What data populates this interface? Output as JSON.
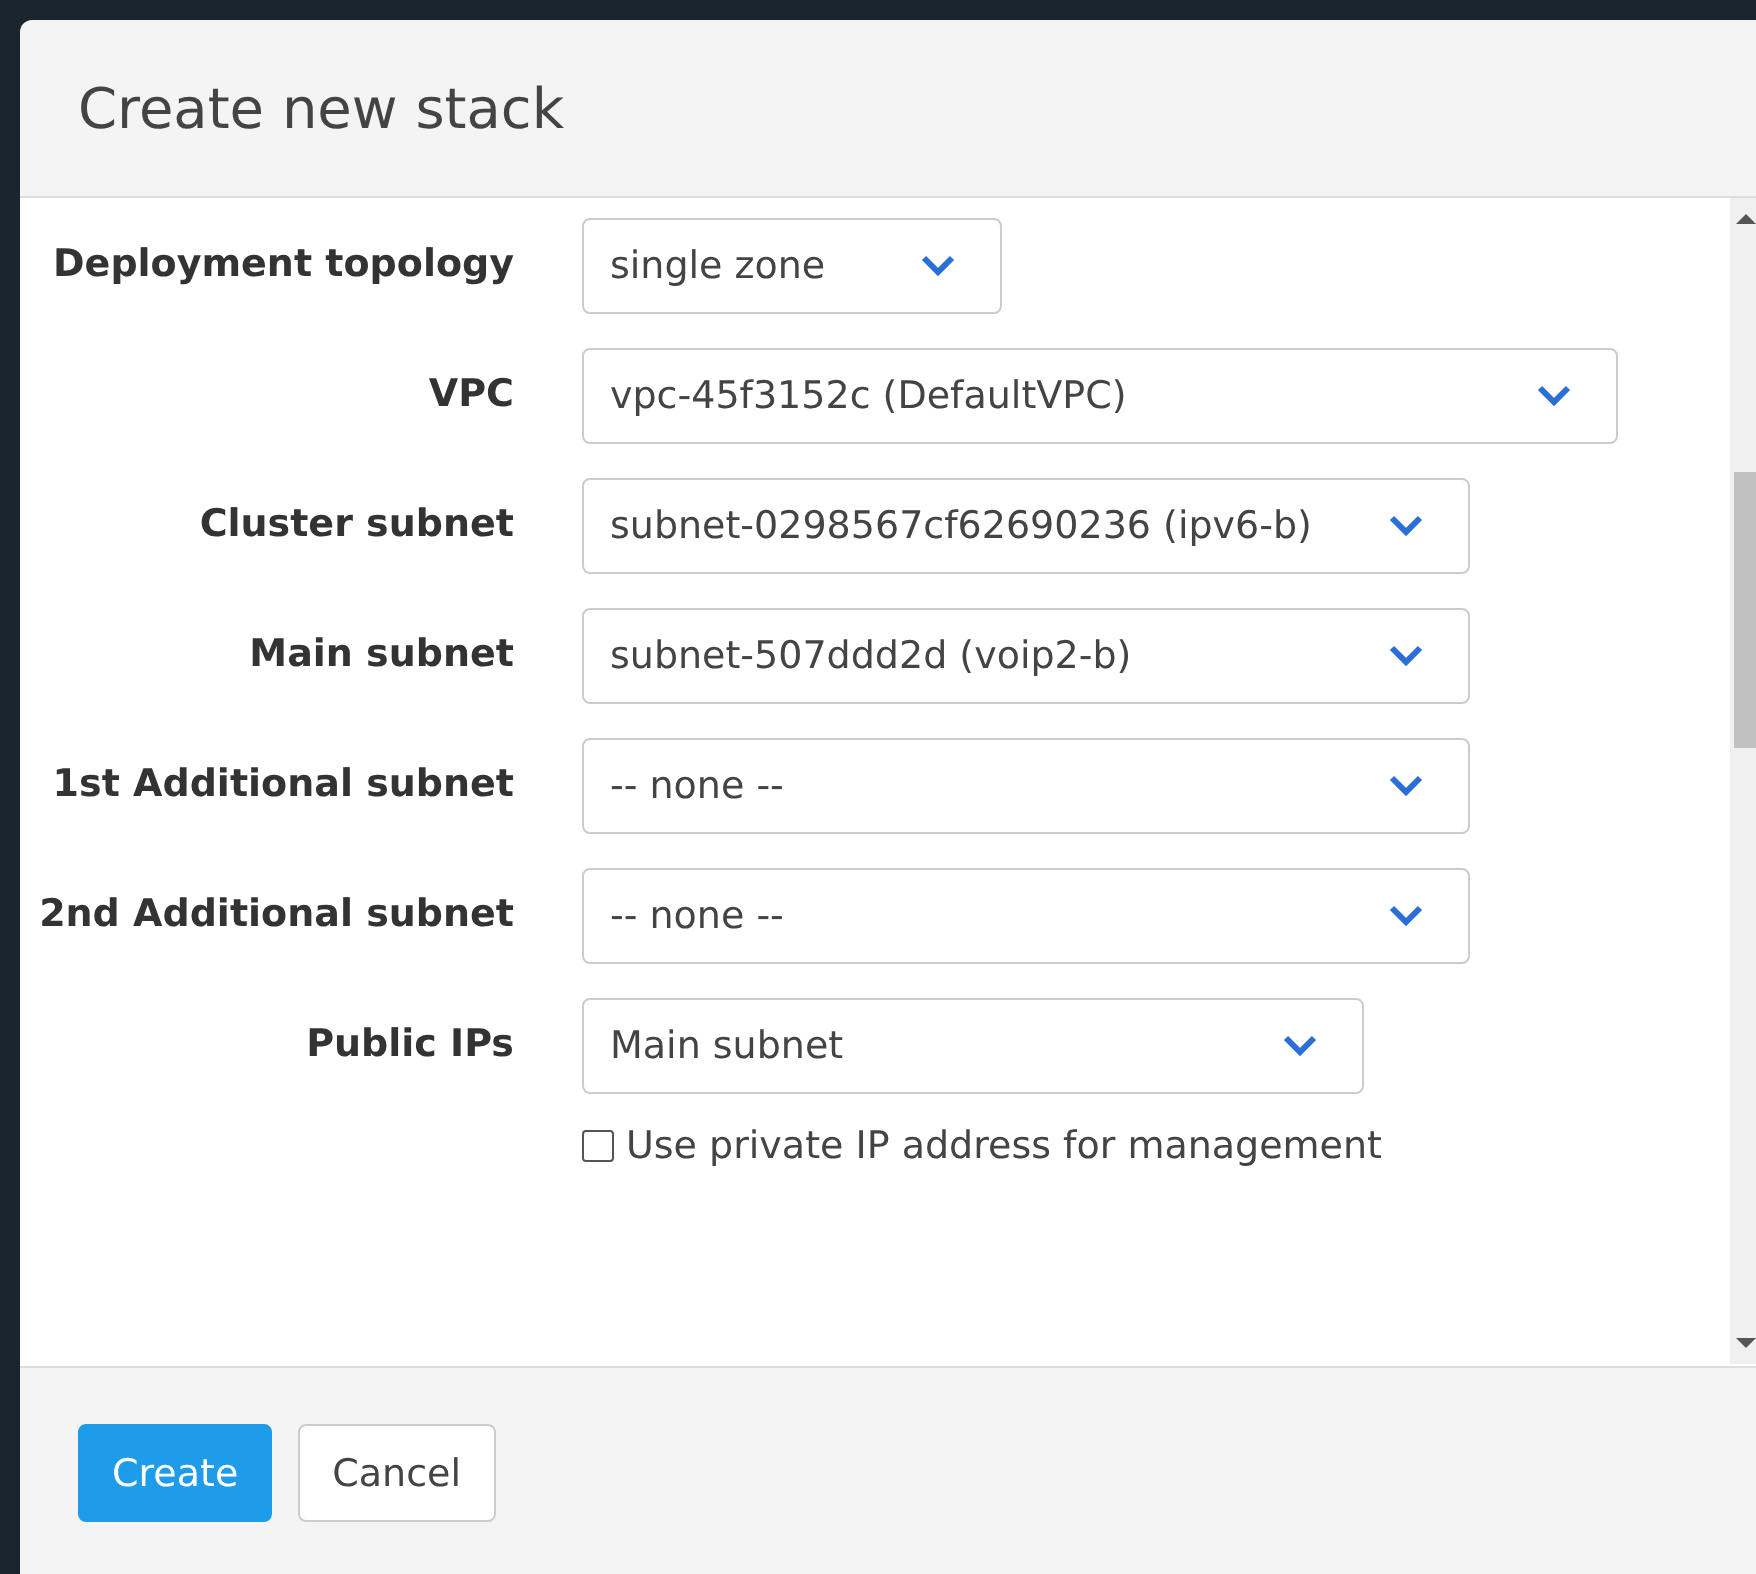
{
  "dialog": {
    "title": "Create new stack"
  },
  "fields": [
    {
      "label": "Deployment topology",
      "value": "single zone"
    },
    {
      "label": "VPC",
      "value": "vpc-45f3152c (DefaultVPC)"
    },
    {
      "label": "Cluster subnet",
      "value": "subnet-0298567cf62690236 (ipv6-b)"
    },
    {
      "label": "Main subnet",
      "value": "subnet-507ddd2d (voip2-b)"
    },
    {
      "label": "1st Additional subnet",
      "value": "-- none --"
    },
    {
      "label": "2nd Additional subnet",
      "value": "-- none --"
    },
    {
      "label": "Public IPs",
      "value": "Main subnet"
    }
  ],
  "checkbox": {
    "label": "Use private IP address for management",
    "checked": false
  },
  "buttons": [
    {
      "label": "Create",
      "kind": "primary"
    },
    {
      "label": "Cancel",
      "kind": "default"
    }
  ]
}
